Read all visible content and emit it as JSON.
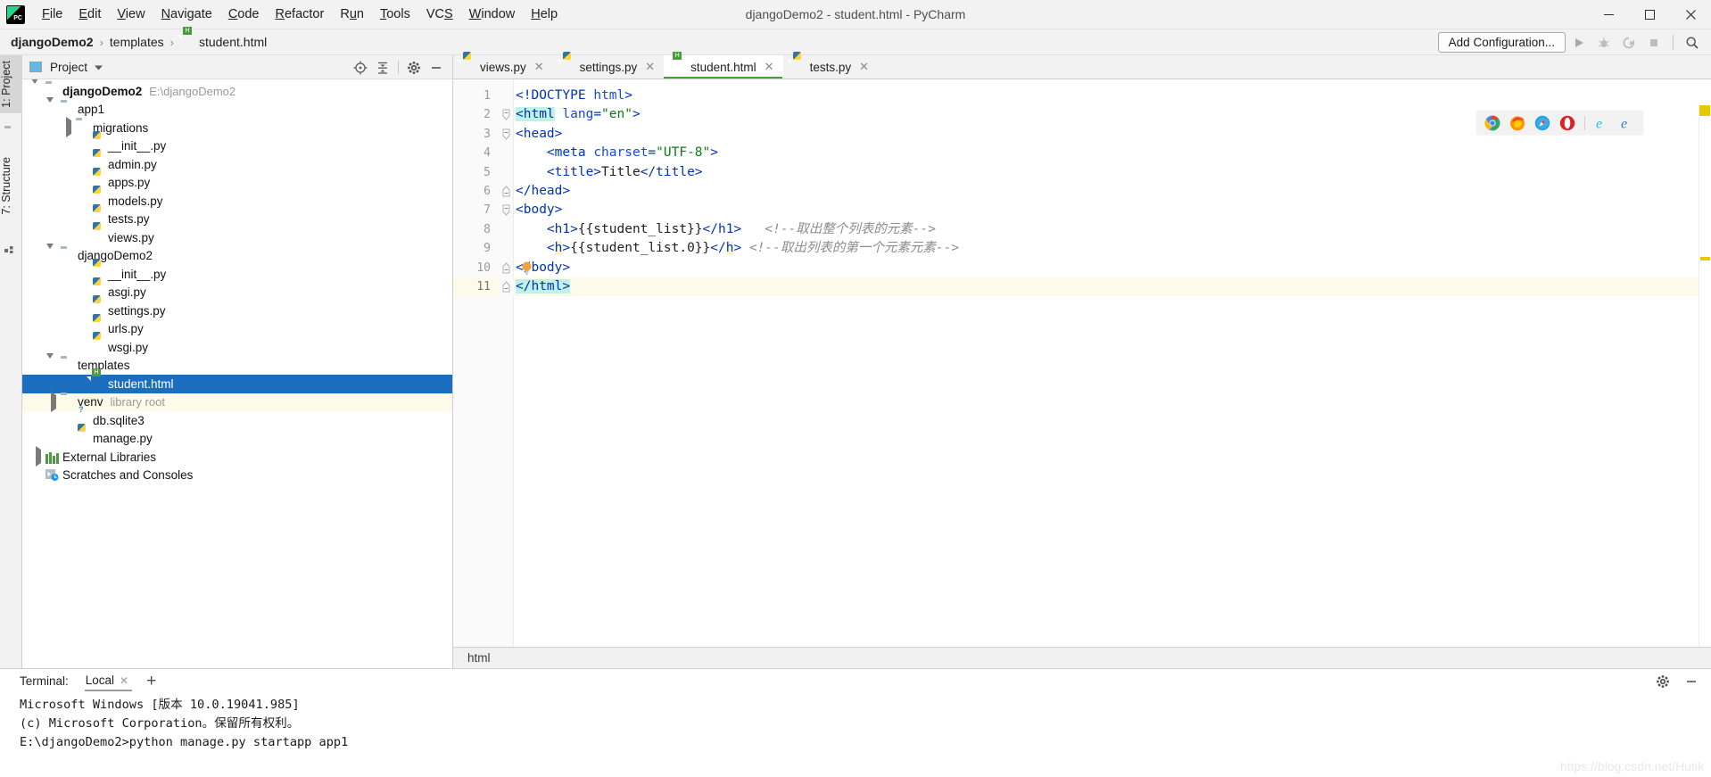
{
  "window": {
    "title": "djangoDemo2 - student.html - PyCharm",
    "minimize": "–",
    "maximize": "❐",
    "close": "✕"
  },
  "menubar": {
    "items": [
      {
        "label": "File",
        "mnemonic": "F"
      },
      {
        "label": "Edit",
        "mnemonic": "E"
      },
      {
        "label": "View",
        "mnemonic": "V"
      },
      {
        "label": "Navigate",
        "mnemonic": "N"
      },
      {
        "label": "Code",
        "mnemonic": "C"
      },
      {
        "label": "Refactor",
        "mnemonic": "R"
      },
      {
        "label": "Run",
        "mnemonic": "u"
      },
      {
        "label": "Tools",
        "mnemonic": "T"
      },
      {
        "label": "VCS",
        "mnemonic": "S"
      },
      {
        "label": "Window",
        "mnemonic": "W"
      },
      {
        "label": "Help",
        "mnemonic": "H"
      }
    ]
  },
  "breadcrumbs": {
    "project": "djangoDemo2",
    "folder": "templates",
    "file": "student.html",
    "separator": "›"
  },
  "toolbar": {
    "add_configuration": "Add Configuration...",
    "run_icon": "run-icon",
    "debug_icon": "debug-icon",
    "coverage_icon": "run-with-coverage-icon",
    "stop_icon": "stop-icon",
    "search_icon": "search-everywhere-icon"
  },
  "left_toolbar": {
    "tabs": [
      {
        "label": "1: Project",
        "icon": "project-folder-icon",
        "active": true
      },
      {
        "label": "7: Structure",
        "icon": "structure-icon",
        "active": false
      }
    ]
  },
  "project_panel": {
    "title": "Project",
    "icons": [
      "locate-icon",
      "collapse-all-icon",
      "settings-gear-icon",
      "hide-icon"
    ],
    "tree": [
      {
        "depth": 0,
        "arrow": "down",
        "icon": "folder-icon",
        "label": "djangoDemo2",
        "bold": true,
        "sub": "E:\\djangoDemo2"
      },
      {
        "depth": 1,
        "arrow": "down",
        "icon": "source-folder-icon",
        "label": "app1",
        "bold": false,
        "sub": ""
      },
      {
        "depth": 2,
        "arrow": "right",
        "icon": "source-folder-icon",
        "label": "migrations",
        "bold": false,
        "sub": ""
      },
      {
        "depth": 3,
        "arrow": "none",
        "icon": "python-file-icon",
        "label": "__init__.py",
        "bold": false,
        "sub": ""
      },
      {
        "depth": 3,
        "arrow": "none",
        "icon": "python-file-icon",
        "label": "admin.py",
        "bold": false,
        "sub": ""
      },
      {
        "depth": 3,
        "arrow": "none",
        "icon": "python-file-icon",
        "label": "apps.py",
        "bold": false,
        "sub": ""
      },
      {
        "depth": 3,
        "arrow": "none",
        "icon": "python-file-icon",
        "label": "models.py",
        "bold": false,
        "sub": ""
      },
      {
        "depth": 3,
        "arrow": "none",
        "icon": "python-file-icon",
        "label": "tests.py",
        "bold": false,
        "sub": ""
      },
      {
        "depth": 3,
        "arrow": "none",
        "icon": "python-file-icon",
        "label": "views.py",
        "bold": false,
        "sub": ""
      },
      {
        "depth": 1,
        "arrow": "down",
        "icon": "source-folder-icon",
        "label": "djangoDemo2",
        "bold": false,
        "sub": ""
      },
      {
        "depth": 3,
        "arrow": "none",
        "icon": "python-file-icon",
        "label": "__init__.py",
        "bold": false,
        "sub": ""
      },
      {
        "depth": 3,
        "arrow": "none",
        "icon": "python-file-icon",
        "label": "asgi.py",
        "bold": false,
        "sub": ""
      },
      {
        "depth": 3,
        "arrow": "none",
        "icon": "python-file-icon",
        "label": "settings.py",
        "bold": false,
        "sub": ""
      },
      {
        "depth": 3,
        "arrow": "none",
        "icon": "python-file-icon",
        "label": "urls.py",
        "bold": false,
        "sub": ""
      },
      {
        "depth": 3,
        "arrow": "none",
        "icon": "python-file-icon",
        "label": "wsgi.py",
        "bold": false,
        "sub": ""
      },
      {
        "depth": 1,
        "arrow": "down",
        "icon": "folder-icon",
        "label": "templates",
        "bold": false,
        "sub": ""
      },
      {
        "depth": 3,
        "arrow": "none",
        "icon": "html-file-icon",
        "label": "student.html",
        "bold": false,
        "sub": "",
        "state": "selected"
      },
      {
        "depth": 1,
        "arrow": "right",
        "icon": "folder-icon",
        "label": "venv",
        "bold": false,
        "sub": "library root",
        "state": "highlight"
      },
      {
        "depth": 2,
        "arrow": "none",
        "icon": "db-file-icon",
        "label": "db.sqlite3",
        "bold": false,
        "sub": ""
      },
      {
        "depth": 2,
        "arrow": "none",
        "icon": "python-file-icon",
        "label": "manage.py",
        "bold": false,
        "sub": ""
      },
      {
        "depth": 0,
        "arrow": "right",
        "icon": "library-icon",
        "label": "External Libraries",
        "bold": false,
        "sub": ""
      },
      {
        "depth": 0,
        "arrow": "none",
        "icon": "scratches-icon",
        "label": "Scratches and Consoles",
        "bold": false,
        "sub": ""
      }
    ]
  },
  "editor": {
    "tabs": [
      {
        "label": "views.py",
        "icon": "python-file-icon",
        "active": false,
        "close": "✕"
      },
      {
        "label": "settings.py",
        "icon": "python-file-icon",
        "active": false,
        "close": "✕"
      },
      {
        "label": "student.html",
        "icon": "html-file-icon",
        "active": true,
        "close": "✕"
      },
      {
        "label": "tests.py",
        "icon": "python-file-icon",
        "active": false,
        "close": "✕"
      }
    ],
    "line_numbers": [
      "1",
      "2",
      "3",
      "4",
      "5",
      "6",
      "7",
      "8",
      "9",
      "10",
      "11"
    ],
    "current_line": 11,
    "code_lines": [
      {
        "n": 1,
        "fold": "none",
        "segments": [
          {
            "t": "<!DOCTYPE ",
            "c": "tag"
          },
          {
            "t": "html",
            "c": "attr"
          },
          {
            "t": ">",
            "c": "tag"
          }
        ]
      },
      {
        "n": 2,
        "fold": "open",
        "segments": [
          {
            "t": "<html",
            "c": "tag",
            "hl": "match"
          },
          {
            "t": " ",
            "c": "txt"
          },
          {
            "t": "lang",
            "c": "attr"
          },
          {
            "t": "=",
            "c": "tag"
          },
          {
            "t": "\"en\"",
            "c": "str"
          },
          {
            "t": ">",
            "c": "tag"
          }
        ]
      },
      {
        "n": 3,
        "fold": "open",
        "segments": [
          {
            "t": "<head>",
            "c": "tag"
          }
        ]
      },
      {
        "n": 4,
        "fold": "none",
        "segments": [
          {
            "t": "    <meta ",
            "c": "tag"
          },
          {
            "t": "charset",
            "c": "attr"
          },
          {
            "t": "=",
            "c": "tag"
          },
          {
            "t": "\"UTF-8\"",
            "c": "str"
          },
          {
            "t": ">",
            "c": "tag"
          }
        ]
      },
      {
        "n": 5,
        "fold": "none",
        "segments": [
          {
            "t": "    <title>",
            "c": "tag"
          },
          {
            "t": "Title",
            "c": "txt"
          },
          {
            "t": "</title>",
            "c": "tag"
          }
        ]
      },
      {
        "n": 6,
        "fold": "close",
        "segments": [
          {
            "t": "</head>",
            "c": "tag"
          }
        ]
      },
      {
        "n": 7,
        "fold": "open",
        "segments": [
          {
            "t": "<body>",
            "c": "tag"
          }
        ]
      },
      {
        "n": 8,
        "fold": "none",
        "segments": [
          {
            "t": "    <h1>",
            "c": "tag"
          },
          {
            "t": "{{student_list}}",
            "c": "txt"
          },
          {
            "t": "</h1>",
            "c": "tag"
          },
          {
            "t": "   ",
            "c": "txt"
          },
          {
            "t": "<!--取出整个列表的元素-->",
            "c": "cmt"
          }
        ]
      },
      {
        "n": 9,
        "fold": "none",
        "segments": [
          {
            "t": "    <",
            "c": "tag"
          },
          {
            "t": "h",
            "c": "tag",
            "hl": "warn"
          },
          {
            "t": ">",
            "c": "tag"
          },
          {
            "t": "{{student_list.0}}",
            "c": "txt"
          },
          {
            "t": "</",
            "c": "tag"
          },
          {
            "t": "h",
            "c": "tag",
            "hl": "warn"
          },
          {
            "t": "> ",
            "c": "tag"
          },
          {
            "t": "<!--取出列表的第一个元素元素-->",
            "c": "cmt"
          }
        ]
      },
      {
        "n": 10,
        "fold": "close",
        "segments": [
          {
            "t": "</body>",
            "c": "tag"
          }
        ],
        "bulb": true
      },
      {
        "n": 11,
        "fold": "close",
        "segments": [
          {
            "t": "</html>",
            "c": "tag",
            "hl": "match"
          }
        ],
        "current": true
      }
    ],
    "browser_icons": [
      {
        "name": "chrome-icon"
      },
      {
        "name": "firefox-icon"
      },
      {
        "name": "safari-icon"
      },
      {
        "name": "opera-icon"
      },
      {
        "name": "internet-explorer-icon"
      },
      {
        "name": "edge-icon"
      }
    ],
    "breadcrumb": "html"
  },
  "terminal": {
    "label": "Terminal:",
    "tab": "Local",
    "tab_close": "✕",
    "add": "+",
    "settings_icon": "settings-gear-icon",
    "hide_icon": "hide-icon",
    "lines": [
      "Microsoft Windows [版本 10.0.19041.985]",
      "(c) Microsoft Corporation。保留所有权利。",
      "E:\\djangoDemo2>python manage.py startapp app1"
    ]
  },
  "watermark": "https://blog.csdn.net/Hutik",
  "colors": {
    "selection_blue": "#1a6ebd",
    "highlight_yellow": "#fcfbe9",
    "tag_blue": "#0033b3",
    "string_green": "#067d17",
    "comment_gray": "#8c8c8c",
    "accent_green": "#4a9c3f",
    "warning_marker": "#e8c800"
  }
}
